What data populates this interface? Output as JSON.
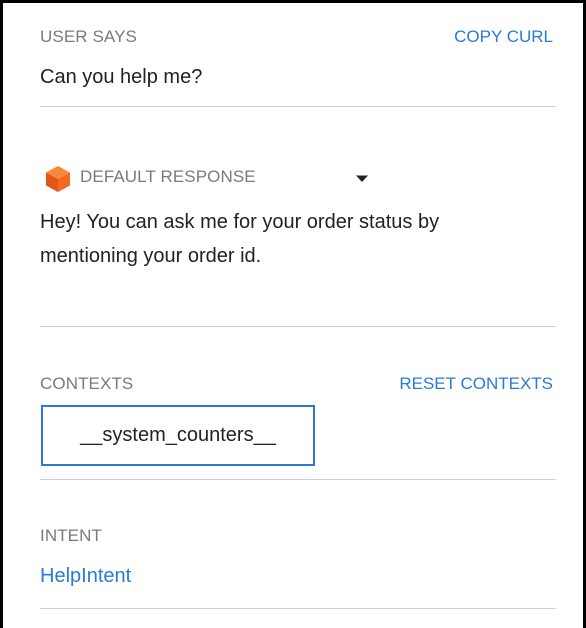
{
  "user_says": {
    "label": "USER SAYS",
    "copy_curl_label": "COPY CURL",
    "text": "Can you help me?"
  },
  "default_response": {
    "label": "DEFAULT RESPONSE",
    "icon": "cube-icon",
    "dropdown_icon": "caret-down-icon",
    "text_line1": "Hey! You can ask me for your order status by",
    "text_line2": "mentioning your order id."
  },
  "contexts": {
    "label": "CONTEXTS",
    "reset_label": "RESET CONTEXTS",
    "items": [
      "__system_counters__"
    ]
  },
  "intent": {
    "label": "INTENT",
    "name": "HelpIntent"
  },
  "colors": {
    "accent": "#2b7bd6",
    "label_gray": "#7a7a7a",
    "divider": "#cfcfcf",
    "icon_orange": "#f26b1d"
  }
}
